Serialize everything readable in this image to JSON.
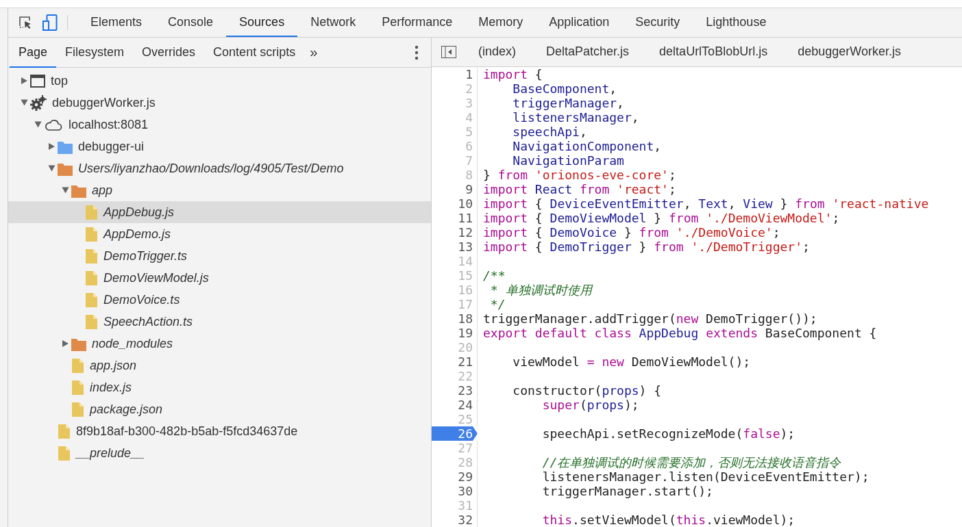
{
  "main_tabs": [
    {
      "label": "Elements",
      "selected": false
    },
    {
      "label": "Console",
      "selected": false
    },
    {
      "label": "Sources",
      "selected": true
    },
    {
      "label": "Network",
      "selected": false
    },
    {
      "label": "Performance",
      "selected": false
    },
    {
      "label": "Memory",
      "selected": false
    },
    {
      "label": "Application",
      "selected": false
    },
    {
      "label": "Security",
      "selected": false
    },
    {
      "label": "Lighthouse",
      "selected": false
    }
  ],
  "device_toolbar": {
    "on": true
  },
  "navigator": {
    "tabs": [
      {
        "label": "Page",
        "selected": true
      },
      {
        "label": "Filesystem",
        "selected": false
      },
      {
        "label": "Overrides",
        "selected": false
      },
      {
        "label": "Content scripts",
        "selected": false
      }
    ],
    "more_tabs": "»",
    "tree": [
      {
        "kind": "frame",
        "label": "top",
        "expanded": false,
        "selected": false,
        "italic": false
      },
      {
        "kind": "worker",
        "label": "debuggerWorker.js",
        "expanded": true,
        "selected": false,
        "italic": false,
        "children": [
          {
            "kind": "cloud",
            "label": "localhost:8081",
            "expanded": true,
            "selected": false,
            "italic": false,
            "children": [
              {
                "kind": "folder",
                "color": "#6aa6ef",
                "label": "debugger-ui",
                "expanded": false,
                "selected": false,
                "italic": false
              },
              {
                "kind": "folder",
                "color": "#e08a4a",
                "label": "Users/liyanzhao/Downloads/log/4905/Test/Demo",
                "expanded": true,
                "selected": false,
                "italic": true,
                "children": [
                  {
                    "kind": "folder",
                    "color": "#e08a4a",
                    "label": "app",
                    "expanded": true,
                    "selected": false,
                    "italic": true,
                    "children": [
                      {
                        "kind": "file",
                        "label": "AppDebug.js",
                        "selected": true,
                        "italic": true
                      },
                      {
                        "kind": "file",
                        "label": "AppDemo.js",
                        "selected": false,
                        "italic": true
                      },
                      {
                        "kind": "file",
                        "label": "DemoTrigger.ts",
                        "selected": false,
                        "italic": true
                      },
                      {
                        "kind": "file",
                        "label": "DemoViewModel.js",
                        "selected": false,
                        "italic": true
                      },
                      {
                        "kind": "file",
                        "label": "DemoVoice.ts",
                        "selected": false,
                        "italic": true
                      },
                      {
                        "kind": "file",
                        "label": "SpeechAction.ts",
                        "selected": false,
                        "italic": true
                      }
                    ]
                  },
                  {
                    "kind": "folder",
                    "color": "#e08a4a",
                    "label": "node_modules",
                    "expanded": false,
                    "selected": false,
                    "italic": true
                  },
                  {
                    "kind": "file",
                    "label": "app.json",
                    "selected": false,
                    "italic": true
                  },
                  {
                    "kind": "file",
                    "label": "index.js",
                    "selected": false,
                    "italic": true
                  },
                  {
                    "kind": "file",
                    "label": "package.json",
                    "selected": false,
                    "italic": true
                  }
                ]
              },
              {
                "kind": "file",
                "label": "8f9b18af-b300-482b-b5ab-f5fcd34637de",
                "selected": false,
                "italic": false
              },
              {
                "kind": "file",
                "label": "__prelude__",
                "selected": false,
                "italic": true
              }
            ]
          }
        ]
      }
    ]
  },
  "editor": {
    "tabs": [
      {
        "label": "(index)",
        "selected": false
      },
      {
        "label": "DeltaPatcher.js",
        "selected": false
      },
      {
        "label": "deltaUrlToBlobUrl.js",
        "selected": false
      },
      {
        "label": "debuggerWorker.js",
        "selected": false
      }
    ],
    "lines": [
      {
        "number": "1",
        "executable": true,
        "breakpoint": false,
        "tokens": [
          {
            "kind": "kw",
            "text": "import"
          },
          {
            "kind": "plain",
            "text": " {"
          }
        ]
      },
      {
        "number": "2",
        "executable": false,
        "breakpoint": false,
        "tokens": [
          {
            "kind": "var",
            "text": "    BaseComponent"
          },
          {
            "kind": "plain",
            "text": ","
          }
        ]
      },
      {
        "number": "3",
        "executable": false,
        "breakpoint": false,
        "tokens": [
          {
            "kind": "var",
            "text": "    triggerManager"
          },
          {
            "kind": "plain",
            "text": ","
          }
        ]
      },
      {
        "number": "4",
        "executable": false,
        "breakpoint": false,
        "tokens": [
          {
            "kind": "var",
            "text": "    listenersManager"
          },
          {
            "kind": "plain",
            "text": ","
          }
        ]
      },
      {
        "number": "5",
        "executable": false,
        "breakpoint": false,
        "tokens": [
          {
            "kind": "var",
            "text": "    speechApi"
          },
          {
            "kind": "plain",
            "text": ","
          }
        ]
      },
      {
        "number": "6",
        "executable": false,
        "breakpoint": false,
        "tokens": [
          {
            "kind": "var",
            "text": "    NavigationComponent"
          },
          {
            "kind": "plain",
            "text": ","
          }
        ]
      },
      {
        "number": "7",
        "executable": false,
        "breakpoint": false,
        "tokens": [
          {
            "kind": "var",
            "text": "    NavigationParam"
          }
        ]
      },
      {
        "number": "8",
        "executable": false,
        "breakpoint": false,
        "tokens": [
          {
            "kind": "plain",
            "text": "} "
          },
          {
            "kind": "kw",
            "text": "from"
          },
          {
            "kind": "str",
            "text": " 'orionos-eve-core'"
          },
          {
            "kind": "plain",
            "text": ";"
          }
        ]
      },
      {
        "number": "9",
        "executable": true,
        "breakpoint": false,
        "tokens": [
          {
            "kind": "kw",
            "text": "import"
          },
          {
            "kind": "var",
            "text": " React"
          },
          {
            "kind": "kw",
            "text": " from"
          },
          {
            "kind": "str",
            "text": " 'react'"
          },
          {
            "kind": "plain",
            "text": ";"
          }
        ]
      },
      {
        "number": "10",
        "executable": true,
        "breakpoint": false,
        "tokens": [
          {
            "kind": "kw",
            "text": "import"
          },
          {
            "kind": "plain",
            "text": " { "
          },
          {
            "kind": "var",
            "text": "DeviceEventEmitter"
          },
          {
            "kind": "plain",
            "text": ", "
          },
          {
            "kind": "var",
            "text": "Text"
          },
          {
            "kind": "plain",
            "text": ", "
          },
          {
            "kind": "var",
            "text": "View"
          },
          {
            "kind": "plain",
            "text": " } "
          },
          {
            "kind": "kw",
            "text": "from"
          },
          {
            "kind": "str",
            "text": " 'react-native"
          }
        ]
      },
      {
        "number": "11",
        "executable": true,
        "breakpoint": false,
        "tokens": [
          {
            "kind": "kw",
            "text": "import"
          },
          {
            "kind": "plain",
            "text": " { "
          },
          {
            "kind": "var",
            "text": "DemoViewModel"
          },
          {
            "kind": "plain",
            "text": " } "
          },
          {
            "kind": "kw",
            "text": "from"
          },
          {
            "kind": "str",
            "text": " './DemoViewModel'"
          },
          {
            "kind": "plain",
            "text": ";"
          }
        ]
      },
      {
        "number": "12",
        "executable": true,
        "breakpoint": false,
        "tokens": [
          {
            "kind": "kw",
            "text": "import"
          },
          {
            "kind": "plain",
            "text": " { "
          },
          {
            "kind": "var",
            "text": "DemoVoice"
          },
          {
            "kind": "plain",
            "text": " } "
          },
          {
            "kind": "kw",
            "text": "from"
          },
          {
            "kind": "str",
            "text": " './DemoVoice'"
          },
          {
            "kind": "plain",
            "text": ";"
          }
        ]
      },
      {
        "number": "13",
        "executable": true,
        "breakpoint": false,
        "tokens": [
          {
            "kind": "kw",
            "text": "import"
          },
          {
            "kind": "plain",
            "text": " { "
          },
          {
            "kind": "var",
            "text": "DemoTrigger"
          },
          {
            "kind": "plain",
            "text": " } "
          },
          {
            "kind": "kw",
            "text": "from"
          },
          {
            "kind": "str",
            "text": " './DemoTrigger'"
          },
          {
            "kind": "plain",
            "text": ";"
          }
        ]
      },
      {
        "number": "14",
        "executable": false,
        "breakpoint": false
      },
      {
        "number": "15",
        "executable": false,
        "breakpoint": false,
        "tokens": [
          {
            "kind": "comment",
            "text": "/**"
          }
        ]
      },
      {
        "number": "16",
        "executable": false,
        "breakpoint": false,
        "tokens": [
          {
            "kind": "comment",
            "text": " * 单独调试时使用"
          }
        ]
      },
      {
        "number": "17",
        "executable": false,
        "breakpoint": false,
        "tokens": [
          {
            "kind": "comment",
            "text": " */"
          }
        ]
      },
      {
        "number": "18",
        "executable": true,
        "breakpoint": false,
        "tokens": [
          {
            "kind": "plain",
            "text": "triggerManager.addTrigger("
          },
          {
            "kind": "kw",
            "text": "new"
          },
          {
            "kind": "plain",
            "text": " DemoTrigger());"
          }
        ]
      },
      {
        "number": "19",
        "executable": true,
        "breakpoint": false,
        "tokens": [
          {
            "kind": "kw",
            "text": "export default class"
          },
          {
            "kind": "var",
            "text": " AppDebug"
          },
          {
            "kind": "kw",
            "text": " extends"
          },
          {
            "kind": "plain",
            "text": " BaseComponent {"
          }
        ]
      },
      {
        "number": "20",
        "executable": false,
        "breakpoint": false
      },
      {
        "number": "21",
        "executable": true,
        "breakpoint": false,
        "tokens": [
          {
            "kind": "plain",
            "text": "    viewModel "
          },
          {
            "kind": "kw",
            "text": "= new"
          },
          {
            "kind": "plain",
            "text": " DemoViewModel();"
          }
        ]
      },
      {
        "number": "22",
        "executable": false,
        "breakpoint": false
      },
      {
        "number": "23",
        "executable": true,
        "breakpoint": false,
        "tokens": [
          {
            "kind": "plain",
            "text": "    constructor("
          },
          {
            "kind": "var",
            "text": "props"
          },
          {
            "kind": "plain",
            "text": ") {"
          }
        ]
      },
      {
        "number": "24",
        "executable": true,
        "breakpoint": false,
        "tokens": [
          {
            "kind": "kw",
            "text": "        super"
          },
          {
            "kind": "plain",
            "text": "("
          },
          {
            "kind": "var",
            "text": "props"
          },
          {
            "kind": "plain",
            "text": ");"
          }
        ]
      },
      {
        "number": "25",
        "executable": false,
        "breakpoint": false
      },
      {
        "number": "26",
        "executable": true,
        "breakpoint": true,
        "tokens": [
          {
            "kind": "plain",
            "text": "        speechApi.setRecognizeMode("
          },
          {
            "kind": "kw",
            "text": "false"
          },
          {
            "kind": "plain",
            "text": ");"
          }
        ]
      },
      {
        "number": "27",
        "executable": false,
        "breakpoint": false
      },
      {
        "number": "28",
        "executable": false,
        "breakpoint": false,
        "tokens": [
          {
            "kind": "comment",
            "text": "        //在单独调试的时候需要添加，否则无法接收语音指令"
          }
        ]
      },
      {
        "number": "29",
        "executable": true,
        "breakpoint": false,
        "tokens": [
          {
            "kind": "plain",
            "text": "        listenersManager.listen(DeviceEventEmitter);"
          }
        ]
      },
      {
        "number": "30",
        "executable": true,
        "breakpoint": false,
        "tokens": [
          {
            "kind": "plain",
            "text": "        triggerManager.start();"
          }
        ]
      },
      {
        "number": "31",
        "executable": false,
        "breakpoint": false
      },
      {
        "number": "32",
        "executable": true,
        "breakpoint": false,
        "tokens": [
          {
            "kind": "kw",
            "text": "        this"
          },
          {
            "kind": "plain",
            "text": ".setViewModel("
          },
          {
            "kind": "kw",
            "text": "this"
          },
          {
            "kind": "plain",
            "text": ".viewModel);"
          }
        ]
      }
    ]
  }
}
